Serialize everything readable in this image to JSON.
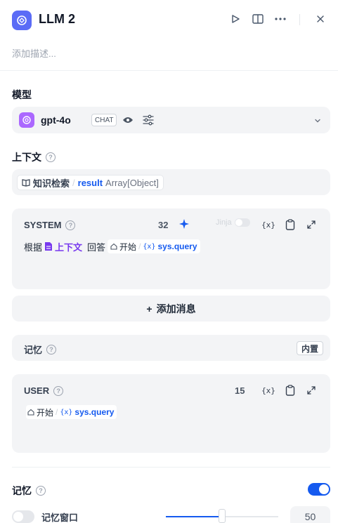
{
  "header": {
    "title": "LLM 2",
    "description_placeholder": "添加描述..."
  },
  "model": {
    "label": "模型",
    "name": "gpt-4o",
    "mode_badge": "CHAT"
  },
  "context": {
    "label": "上下文",
    "node_name": "知识检索",
    "separator": "/",
    "variable": "result",
    "type": "Array[Object]"
  },
  "system_prompt": {
    "title": "SYSTEM",
    "token_count": "32",
    "jinja_label": "Jinja",
    "var_button": "{x}",
    "text_prefix": "根据",
    "context_ref": "上下文",
    "text_mid": "回答",
    "start_node": "开始",
    "separator": "/",
    "var_icon": "{x}",
    "var_name": "sys.query"
  },
  "add_message": {
    "label": "添加消息"
  },
  "memory_section": {
    "label": "记忆",
    "badge": "内置"
  },
  "user_prompt": {
    "title": "USER",
    "token_count": "15",
    "var_button": "{x}",
    "start_node": "开始",
    "separator": "/",
    "var_icon": "{x}",
    "var_name": "sys.query"
  },
  "memory": {
    "label": "记忆",
    "enabled": true,
    "window_label": "记忆窗口",
    "window_enabled": false,
    "window_value": "50",
    "window_fraction": 0.5
  },
  "colors": {
    "accent": "#155aef",
    "context_purple": "#7839ee",
    "app_icon": "#5b6cf6",
    "gpt_icon": "#ab68ff"
  }
}
